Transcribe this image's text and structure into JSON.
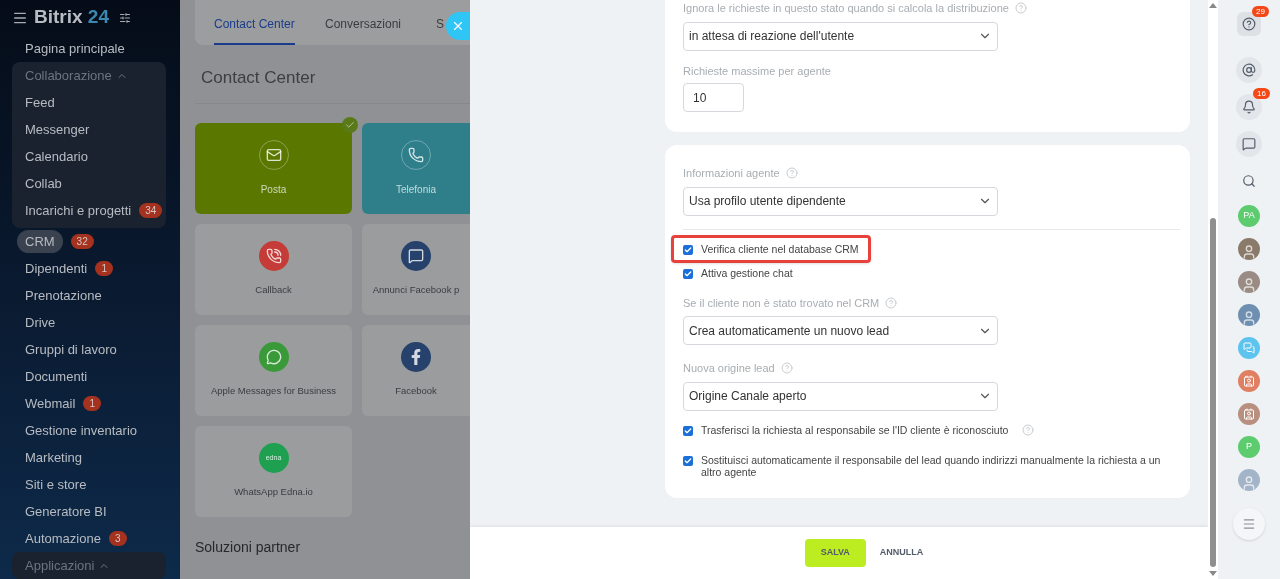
{
  "sidebar": {
    "logo": {
      "name": "Bitrix",
      "number": "24"
    },
    "items": [
      {
        "label": "Pagina principale",
        "selected": false
      },
      {
        "label": "Collaborazione",
        "kind": "group",
        "expanded": true,
        "children": [
          {
            "label": "Feed",
            "selected": false
          },
          {
            "label": "Messenger",
            "selected": false
          },
          {
            "label": "Calendario",
            "selected": false
          },
          {
            "label": "Collab",
            "selected": false
          },
          {
            "label": "Incarichi e progetti",
            "badge": "34",
            "selected": false
          }
        ]
      },
      {
        "label": "CRM",
        "badge": "32",
        "selected": true
      },
      {
        "label": "Dipendenti",
        "badge": "1",
        "selected": false
      },
      {
        "label": "Prenotazione",
        "selected": false
      },
      {
        "label": "Drive",
        "selected": false
      },
      {
        "label": "Gruppi di lavoro",
        "selected": false
      },
      {
        "label": "Documenti",
        "selected": false
      },
      {
        "label": "Webmail",
        "badge": "1",
        "selected": false
      },
      {
        "label": "Gestione inventario",
        "selected": false
      },
      {
        "label": "Marketing",
        "selected": false
      },
      {
        "label": "Siti e store",
        "selected": false
      },
      {
        "label": "Generatore BI",
        "selected": false
      },
      {
        "label": "Automazione",
        "badge": "3",
        "selected": false
      },
      {
        "label": "Applicazioni",
        "kind": "group",
        "expanded": true
      }
    ]
  },
  "page": {
    "tabs": [
      {
        "label": "Contact Center",
        "selected": true
      },
      {
        "label": "Conversazioni",
        "selected": false
      },
      {
        "label": "S",
        "selected": false
      }
    ],
    "title": "Contact Center",
    "tiles": [
      {
        "label": "Posta",
        "kind": "mail",
        "color": "#5a7800",
        "connected": true
      },
      {
        "label": "Telefonia",
        "kind": "phone",
        "color": "#2f7f8a",
        "connected": false
      },
      {
        "label": "Callback",
        "kind": "callback",
        "color": "#c43b37",
        "connected": false
      },
      {
        "label": "Annunci Facebook p",
        "kind": "fbads",
        "color": "#26416b",
        "connected": false
      },
      {
        "label": "Apple Messages for Business",
        "kind": "chat",
        "color": "#3a9a3a",
        "connected": false
      },
      {
        "label": "Facebook",
        "kind": "facebook",
        "color": "#26416b",
        "connected": false
      },
      {
        "label": "WhatsApp Edna.io",
        "kind": "edna",
        "color": "#1ea050",
        "connected": false,
        "logo_text": "edna"
      }
    ],
    "section": "Soluzioni partner"
  },
  "panel": {
    "card1": {
      "field1": {
        "label": "Ignora le richieste in questo stato quando si calcola la distribuzione",
        "value": "in attesa di reazione dell'utente"
      },
      "field2": {
        "label": "Richieste massime per agente",
        "value": "10"
      }
    },
    "card2": {
      "agent_info": {
        "label": "Informazioni agente",
        "value": "Usa profilo utente dipendente"
      },
      "checks1": [
        {
          "label": "Verifica cliente nel database CRM",
          "checked": true,
          "highlighted": true
        },
        {
          "label": "Attiva gestione chat",
          "checked": true,
          "highlighted": false
        }
      ],
      "not_found": {
        "label": "Se il cliente non è stato trovato nel CRM",
        "value": "Crea automaticamente un nuovo lead"
      },
      "source": {
        "label": "Nuova origine lead",
        "value": "Origine Canale aperto"
      },
      "checks2": [
        {
          "label": "Trasferisci la richiesta al responsabile se l'ID cliente è riconosciuto",
          "checked": true,
          "help": true
        },
        {
          "label": "Sostituisci automaticamente il responsabile del lead quando indirizzi manualmente la richiesta a un altro agente",
          "checked": true,
          "help": false
        }
      ]
    },
    "buttons": {
      "save": "SALVA",
      "cancel": "ANNULLA"
    }
  },
  "rail": {
    "help_badge": "29",
    "bell_badge": "16",
    "avatars": [
      {
        "kind": "initials",
        "text": "PA",
        "color": "#5ccc6e"
      },
      {
        "kind": "photo",
        "color": "#8a7a6a"
      },
      {
        "kind": "photo",
        "color": "#9a8c84"
      },
      {
        "kind": "photo",
        "color": "#6f8fb0"
      },
      {
        "kind": "chat",
        "color": "#5cc4ee"
      },
      {
        "kind": "card",
        "color": "#e07f62"
      },
      {
        "kind": "card",
        "color": "#b99080"
      },
      {
        "kind": "initials",
        "text": "P",
        "color": "#5ccc6e"
      },
      {
        "kind": "photo",
        "color": "#a4b4c8"
      }
    ]
  }
}
